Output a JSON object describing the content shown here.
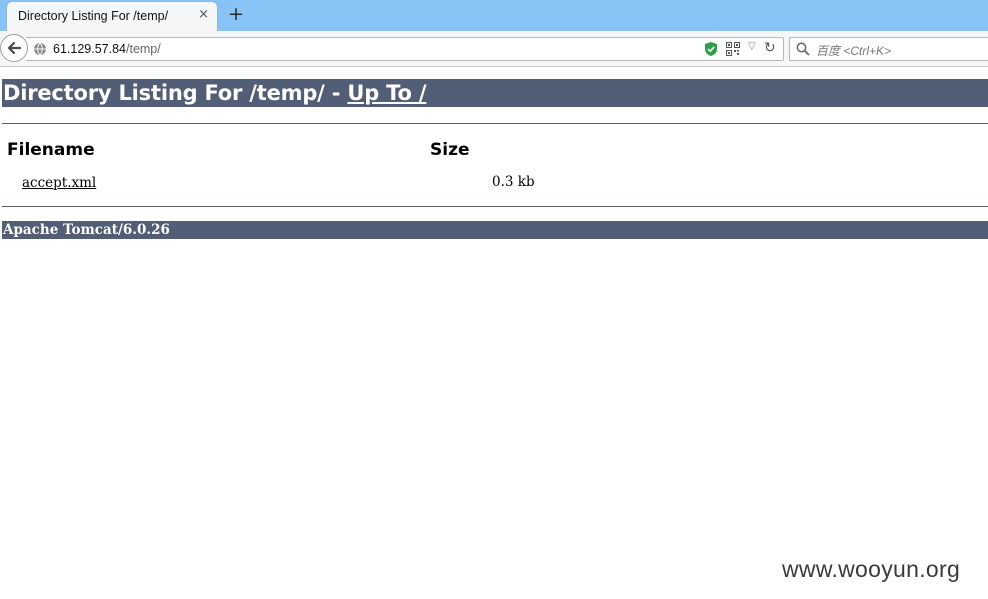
{
  "browser": {
    "tab": {
      "title": "Directory Listing For /temp/",
      "close_glyph": "×"
    },
    "new_tab_glyph": "+",
    "url": {
      "host": "61.129.57.84",
      "path": "/temp/"
    },
    "search_placeholder": "百度 <Ctrl+K>",
    "icons": [
      "back-arrow-icon",
      "globe-icon",
      "shield-icon",
      "qr-code-icon",
      "dropdown-icon",
      "reload-icon",
      "search-icon"
    ],
    "tab_strip_color": "#87c3f5"
  },
  "page": {
    "heading_prefix": "Directory Listing For /temp/ - ",
    "up_link": "Up To /",
    "columns": {
      "filename": "Filename",
      "size": "Size"
    },
    "files": [
      {
        "name": "accept.xml",
        "size": "0.3 kb"
      }
    ],
    "footer": "Apache Tomcat/6.0.26",
    "bar_color": "#525d76"
  },
  "watermark": "www.wooyun.org"
}
